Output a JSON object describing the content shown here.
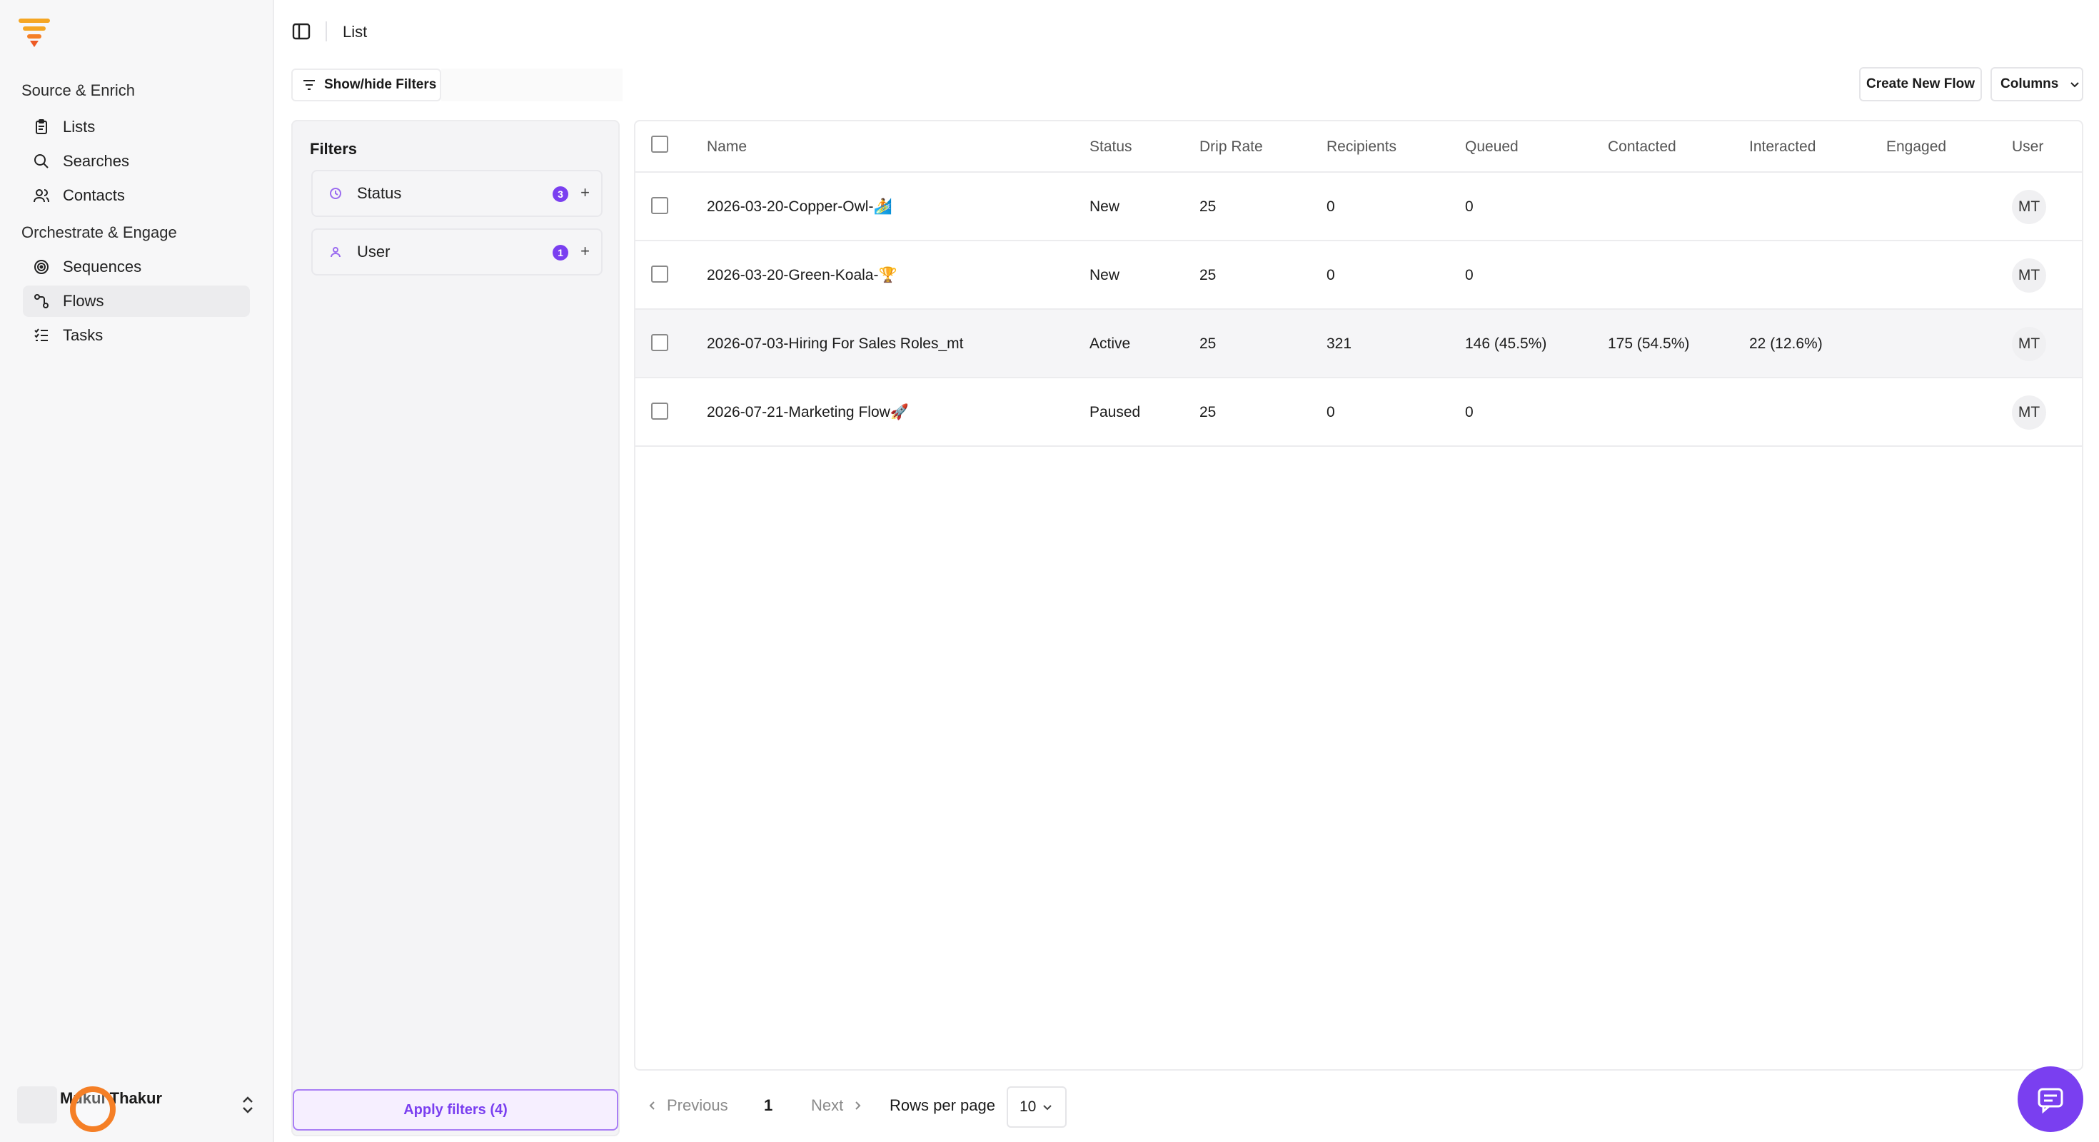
{
  "app": {
    "breadcrumb": "List",
    "brand_color": "#f5a623",
    "accent_color": "#7a3ff0"
  },
  "sidebar": {
    "groups": [
      {
        "label": "Source & Enrich",
        "items": [
          {
            "label": "Lists",
            "icon": "clipboard-icon"
          },
          {
            "label": "Searches",
            "icon": "search-icon"
          },
          {
            "label": "Contacts",
            "icon": "users-icon"
          }
        ]
      },
      {
        "label": "Orchestrate & Engage",
        "items": [
          {
            "label": "Sequences",
            "icon": "target-icon"
          },
          {
            "label": "Flows",
            "icon": "flow-icon",
            "active": true
          },
          {
            "label": "Tasks",
            "icon": "checklist-icon"
          }
        ]
      }
    ],
    "user": {
      "name": "Mukul Thakur"
    }
  },
  "toolbar": {
    "show_hide_filters": "Show/hide Filters",
    "create_new_flow": "Create New Flow",
    "columns": "Columns"
  },
  "filters": {
    "title": "Filters",
    "items": [
      {
        "label": "Status",
        "count": "3",
        "icon": "clock-icon"
      },
      {
        "label": "User",
        "count": "1",
        "icon": "person-icon"
      }
    ],
    "apply_label": "Apply filters (4)"
  },
  "table": {
    "columns": [
      "Name",
      "Status",
      "Drip Rate",
      "Recipients",
      "Queued",
      "Contacted",
      "Interacted",
      "Engaged",
      "User"
    ],
    "rows": [
      {
        "name": "2026-03-20-Copper-Owl-🏄",
        "status": "New",
        "drip_rate": "25",
        "recipients": "0",
        "queued": "0",
        "contacted": "",
        "interacted": "",
        "engaged": "",
        "user": "MT"
      },
      {
        "name": "2026-03-20-Green-Koala-🏆",
        "status": "New",
        "drip_rate": "25",
        "recipients": "0",
        "queued": "0",
        "contacted": "",
        "interacted": "",
        "engaged": "",
        "user": "MT"
      },
      {
        "name": "2026-07-03-Hiring For Sales Roles_mt",
        "status": "Active",
        "drip_rate": "25",
        "recipients": "321",
        "queued": "146 (45.5%)",
        "contacted": "175 (54.5%)",
        "interacted": "22 (12.6%)",
        "engaged": "",
        "user": "MT"
      },
      {
        "name": "2026-07-21-Marketing Flow🚀",
        "status": "Paused",
        "drip_rate": "25",
        "recipients": "0",
        "queued": "0",
        "contacted": "",
        "interacted": "",
        "engaged": "",
        "user": "MT"
      }
    ]
  },
  "pagination": {
    "previous": "Previous",
    "page": "1",
    "next": "Next",
    "rows_per_page_label": "Rows per page",
    "rows_per_page_value": "10"
  }
}
